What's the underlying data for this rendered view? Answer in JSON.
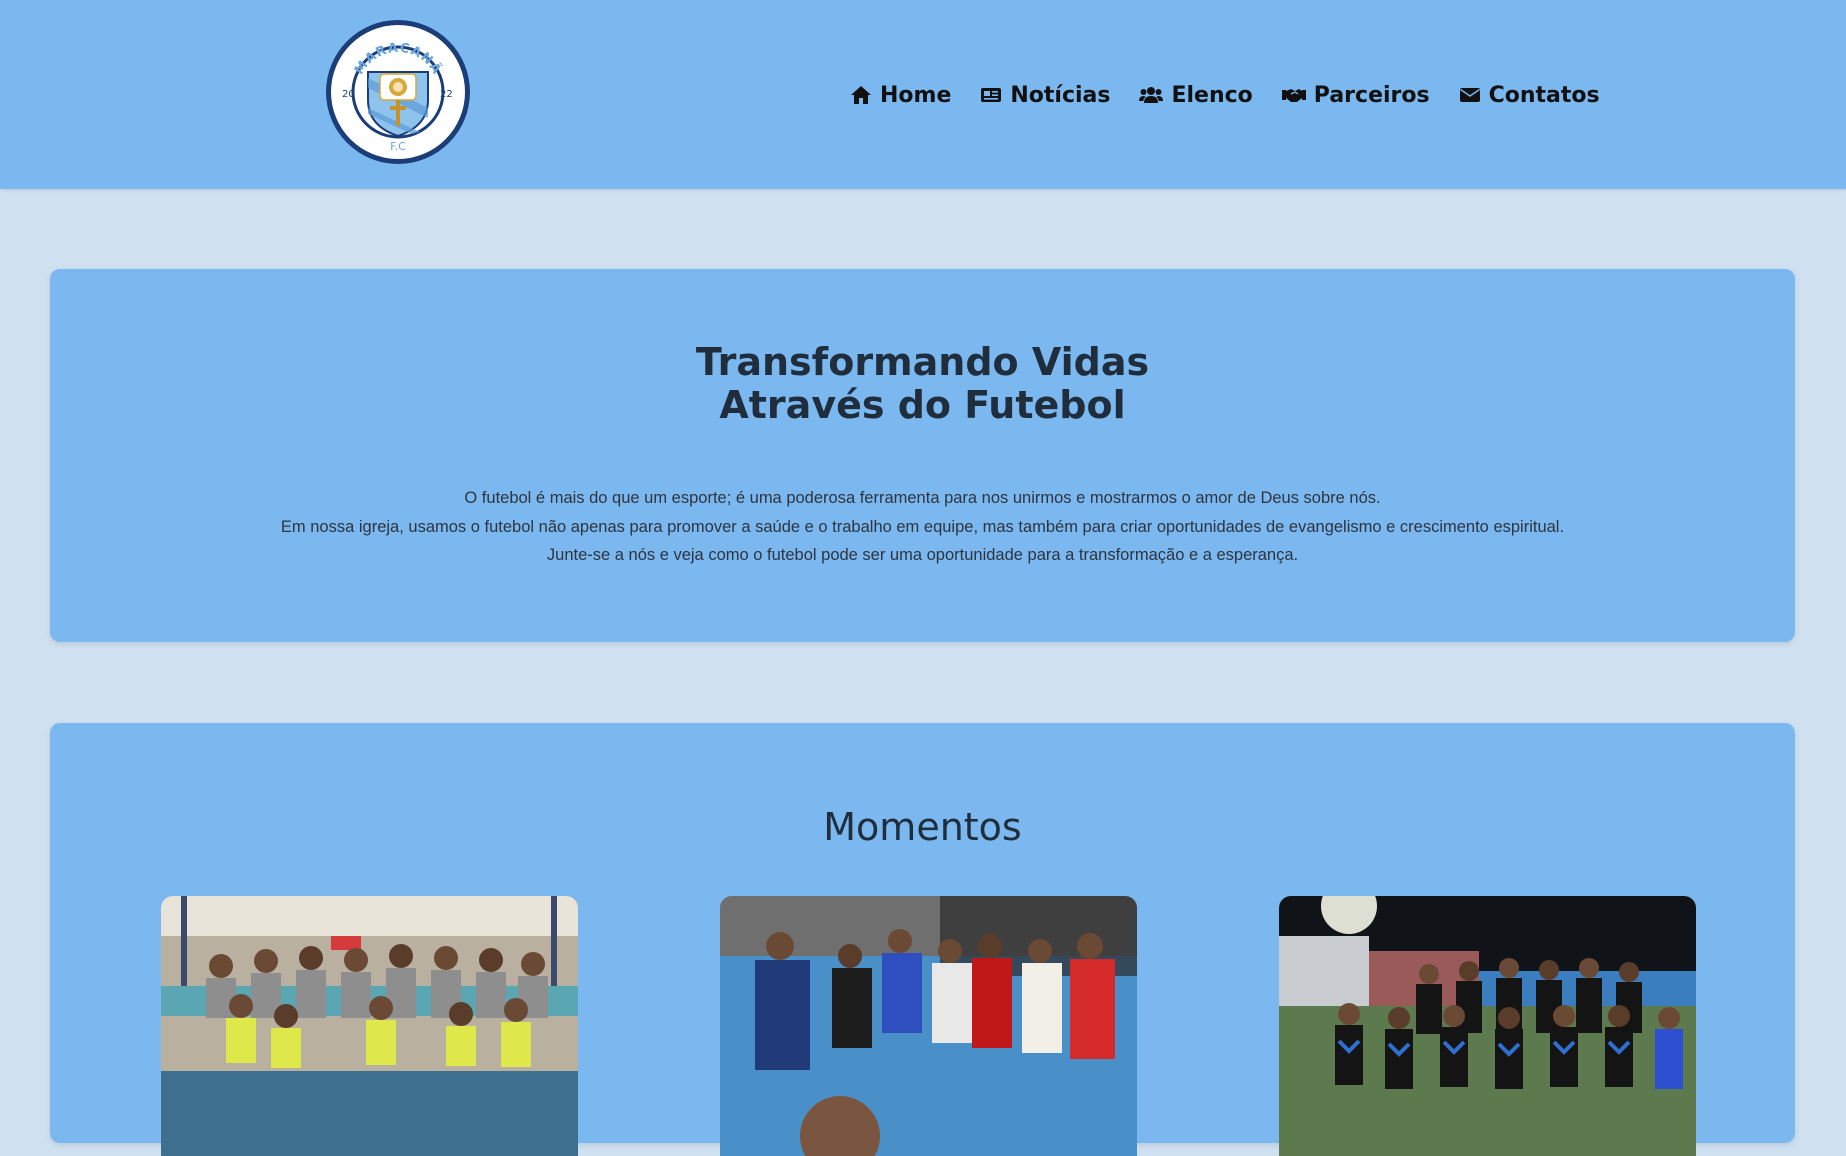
{
  "header": {
    "logo": {
      "arc_text": "MARACANÃ",
      "year_left": "20",
      "year_right": "22",
      "bottom_text": "F.C"
    },
    "nav": [
      {
        "label": "Home",
        "icon": "home-icon"
      },
      {
        "label": "Notícias",
        "icon": "newspaper-icon"
      },
      {
        "label": "Elenco",
        "icon": "users-icon"
      },
      {
        "label": "Parceiros",
        "icon": "handshake-icon"
      },
      {
        "label": "Contatos",
        "icon": "envelope-icon"
      }
    ]
  },
  "hero": {
    "title_line1": "Transformando Vidas",
    "title_line2": "Através do Futebol",
    "paragraph_lines": [
      "O futebol é mais do que um esporte; é uma poderosa ferramenta para nos unirmos e mostrarmos o amor de Deus sobre nós.",
      "Em nossa igreja, usamos o futebol não apenas para promover a saúde e o trabalho em equipe, mas também para criar oportunidades de evangelismo e crescimento espiritual.",
      "Junte-se a nós e veja como o futebol pode ser uma oportunidade para a transformação e a esperança."
    ]
  },
  "moments": {
    "title": "Momentos",
    "photos": [
      {
        "name": "team-photo-indoor-bibs"
      },
      {
        "name": "team-photo-selfie-group"
      },
      {
        "name": "team-photo-night-field"
      }
    ]
  },
  "colors": {
    "page_background": "#cfe0f1",
    "card_background": "#7ab8ef",
    "heading_text": "#1f2d3d",
    "nav_text": "#111111"
  }
}
